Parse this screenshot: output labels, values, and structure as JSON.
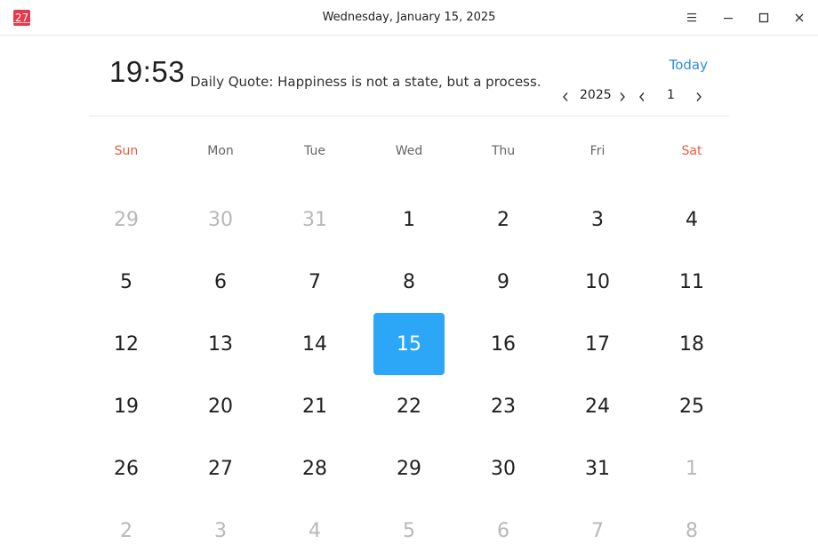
{
  "app": {
    "icon_text": "27",
    "window_title": "Wednesday, January 15, 2025"
  },
  "header": {
    "clock": "19:53",
    "quote": "Daily Quote: Happiness is not a state, but a process.",
    "today_label": "Today",
    "year": "2025",
    "month": "1"
  },
  "colors": {
    "accent": "#2ca7f8",
    "link": "#2f8ae8",
    "weekend": "#e9593a",
    "app_icon": "#e8384a"
  },
  "weekdays": [
    "Sun",
    "Mon",
    "Tue",
    "Wed",
    "Thu",
    "Fri",
    "Sat"
  ],
  "days": [
    [
      "29",
      "30",
      "31",
      "1",
      "2",
      "3",
      "4"
    ],
    [
      "5",
      "6",
      "7",
      "8",
      "9",
      "10",
      "11"
    ],
    [
      "12",
      "13",
      "14",
      "15",
      "16",
      "17",
      "18"
    ],
    [
      "19",
      "20",
      "21",
      "22",
      "23",
      "24",
      "25"
    ],
    [
      "26",
      "27",
      "28",
      "29",
      "30",
      "31",
      "1"
    ],
    [
      "2",
      "3",
      "4",
      "5",
      "6",
      "7",
      "8"
    ]
  ],
  "selected_day": "15"
}
